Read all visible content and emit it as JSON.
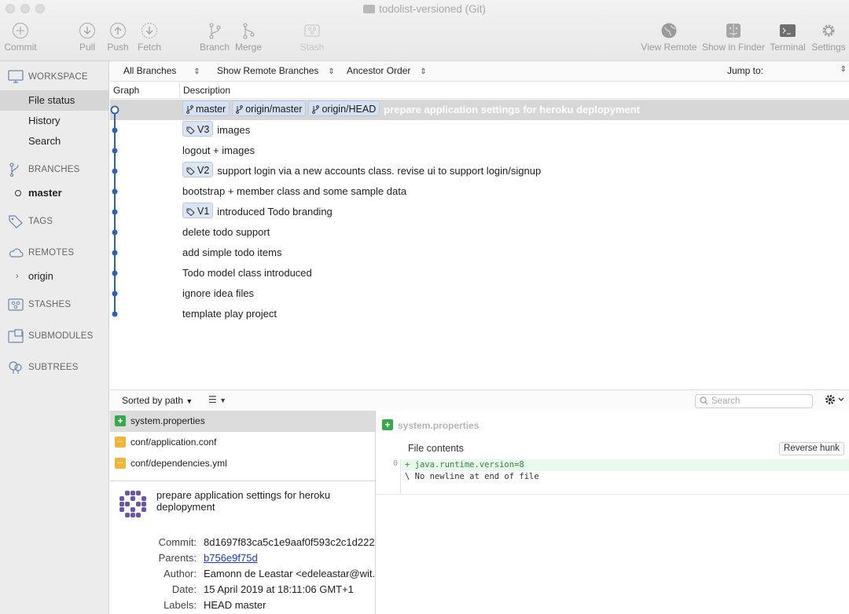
{
  "window": {
    "title": "todolist-versioned (Git)"
  },
  "toolbar": {
    "commit": "Commit",
    "pull": "Pull",
    "push": "Push",
    "fetch": "Fetch",
    "branch": "Branch",
    "merge": "Merge",
    "stash": "Stash",
    "view_remote": "View Remote",
    "show_in_finder": "Show in Finder",
    "terminal": "Terminal",
    "settings": "Settings"
  },
  "sidebar": {
    "workspace": "WORKSPACE",
    "items": [
      "File status",
      "History",
      "Search"
    ],
    "branches": "BRANCHES",
    "branch_current": "master",
    "tags": "TAGS",
    "remotes": "REMOTES",
    "remote_origin": "origin",
    "stashes": "STASHES",
    "submodules": "SUBMODULES",
    "subtrees": "SUBTREES"
  },
  "filters": {
    "branches": "All Branches",
    "remote": "Show Remote Branches",
    "order": "Ancestor Order",
    "jump": "Jump to:"
  },
  "columns": {
    "graph": "Graph",
    "description": "Description"
  },
  "commits": [
    {
      "badges": [
        [
          "branch",
          "master"
        ],
        [
          "branch",
          "origin/master"
        ],
        [
          "branch",
          "origin/HEAD"
        ]
      ],
      "text": "prepare application settings for heroku deplopyment"
    },
    {
      "badges": [
        [
          "tag",
          "V3"
        ]
      ],
      "text": "images"
    },
    {
      "badges": [],
      "text": "logout + images"
    },
    {
      "badges": [
        [
          "tag",
          "V2"
        ]
      ],
      "text": "support login via a new accounts class. revise ui to support login/signup"
    },
    {
      "badges": [],
      "text": "bootstrap + member class and some sample data"
    },
    {
      "badges": [
        [
          "tag",
          "V1"
        ]
      ],
      "text": "introduced Todo branding"
    },
    {
      "badges": [],
      "text": "delete todo support"
    },
    {
      "badges": [],
      "text": "add simple todo items"
    },
    {
      "badges": [],
      "text": "Todo model class introduced"
    },
    {
      "badges": [],
      "text": "ignore idea files"
    },
    {
      "badges": [],
      "text": "template play project"
    }
  ],
  "files_bar": {
    "sort": "Sorted by path",
    "search_placeholder": "Search"
  },
  "files": [
    {
      "status": "added",
      "name": "system.properties"
    },
    {
      "status": "modified",
      "name": "conf/application.conf"
    },
    {
      "status": "modified",
      "name": "conf/dependencies.yml"
    }
  ],
  "details": {
    "message": "prepare application settings for heroku deplopyment",
    "commit_label": "Commit:",
    "commit": "8d1697f83ca5c1e9aaf0f593c2c1d222",
    "parents_label": "Parents:",
    "parents": "b756e9f75d",
    "author_label": "Author:",
    "author": "Eamonn de Leastar <edeleastar@wit.",
    "date_label": "Date:",
    "date": "15 April 2019 at 18:11:06 GMT+1",
    "labels_label": "Labels:",
    "labels": "HEAD master"
  },
  "diff": {
    "filename": "system.properties",
    "hunk_label": "File contents",
    "reverse_button": "Reverse hunk",
    "line_number": "0",
    "added_line": "+ java.runtime.version=8",
    "no_newline": "\\  No newline at end of file"
  }
}
